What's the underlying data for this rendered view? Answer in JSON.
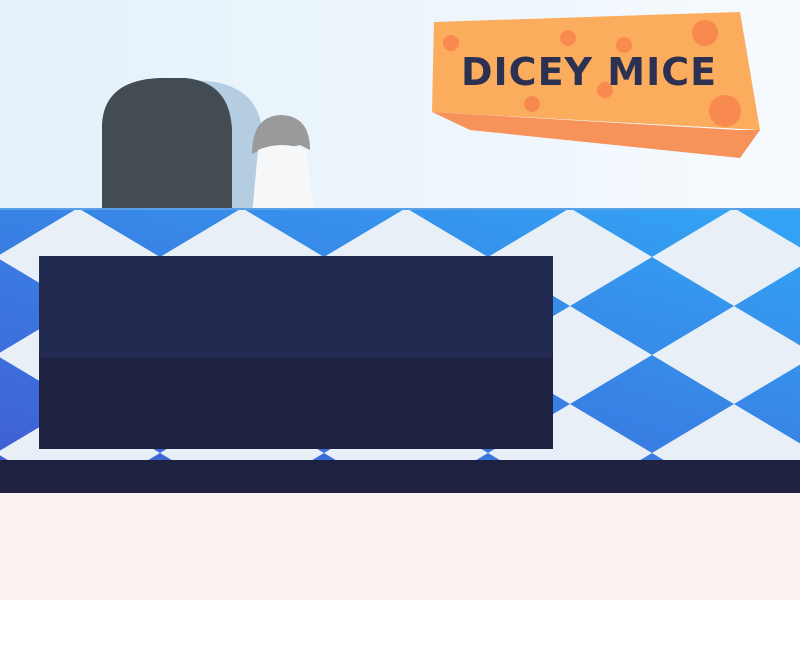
{
  "game": {
    "title": "DICEY MICE"
  },
  "scene": {
    "mouse_hole_icon": "mouse-hole-icon",
    "mouse_icon": "mouse-icon",
    "floor_pattern": "diamond-checker"
  },
  "colors": {
    "floor_blue_start": "#3f5fd3",
    "floor_blue_end": "#32a6f6",
    "floor_white": "#e8eff6",
    "logo_cheese": "#fbac5c",
    "logo_holes": "#f88a4f",
    "logo_text": "#2c3152",
    "panel_top": "#232a52",
    "panel_bottom": "#1e2140",
    "cream": "#fbf3ef"
  }
}
